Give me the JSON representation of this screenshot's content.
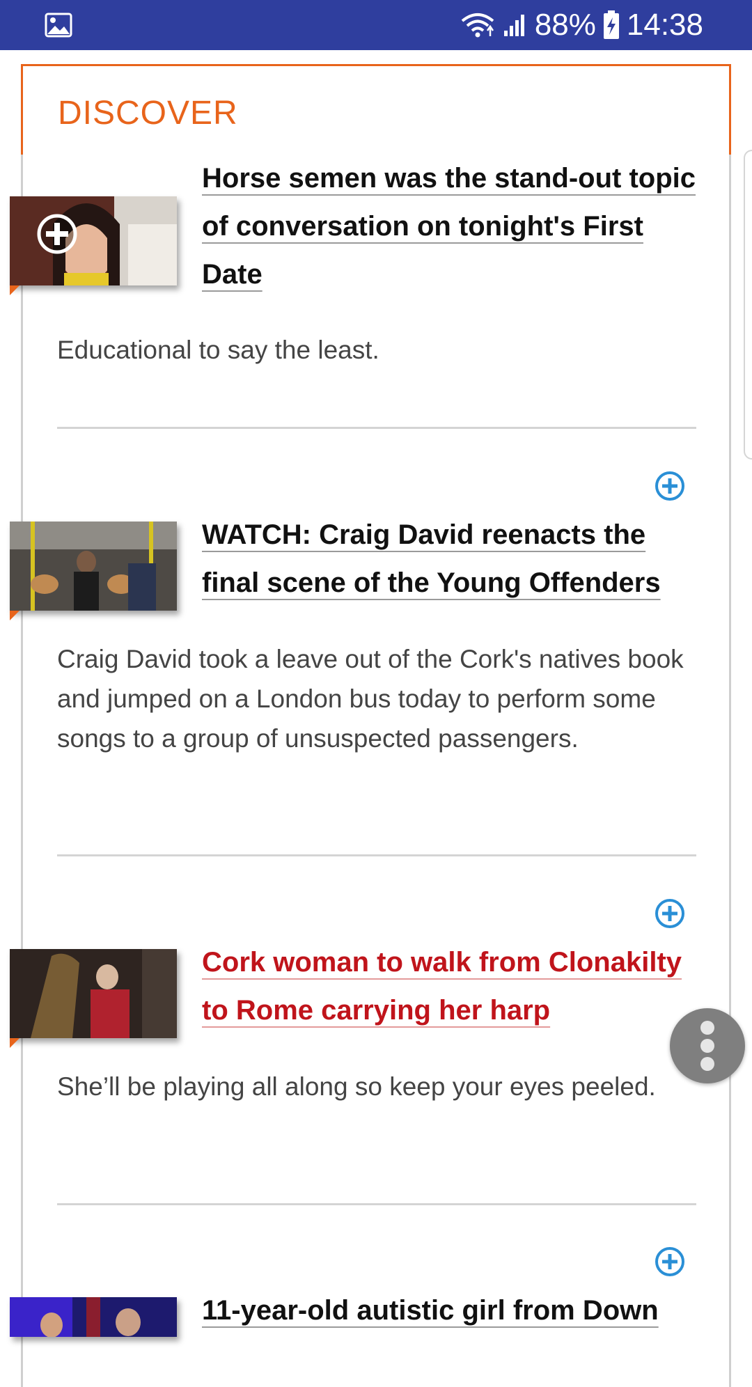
{
  "status_bar": {
    "battery": "88%",
    "time": "14:38",
    "icons": [
      "gallery-icon",
      "wifi-icon",
      "signal-icon",
      "battery-charging-icon"
    ]
  },
  "section": {
    "title": "DISCOVER",
    "accent_color": "#e8641b"
  },
  "articles": [
    {
      "headline": "Horse semen was the stand-out topic of conversation on tonight's First Date",
      "summary": "Educational to say the least.",
      "headline_color": "#111111"
    },
    {
      "headline": "WATCH: Craig David reenacts the final scene of the Young Offenders",
      "summary": "Craig David took a leave out of the Cork's natives book and jumped on a London bus today to perform some songs to a group of unsuspected passengers.",
      "headline_color": "#111111"
    },
    {
      "headline": "Cork woman to walk from Clonakilty to Rome carrying her harp",
      "summary": "She’ll be playing all along so keep your eyes peeled.",
      "headline_color": "#c0141b"
    },
    {
      "headline": "11-year-old autistic girl from Down",
      "summary": "",
      "headline_color": "#111111"
    }
  ],
  "colors": {
    "status_bar": "#2f3e9e",
    "add_icon": "#2a8fd6",
    "fab": "#7f7f7f"
  }
}
